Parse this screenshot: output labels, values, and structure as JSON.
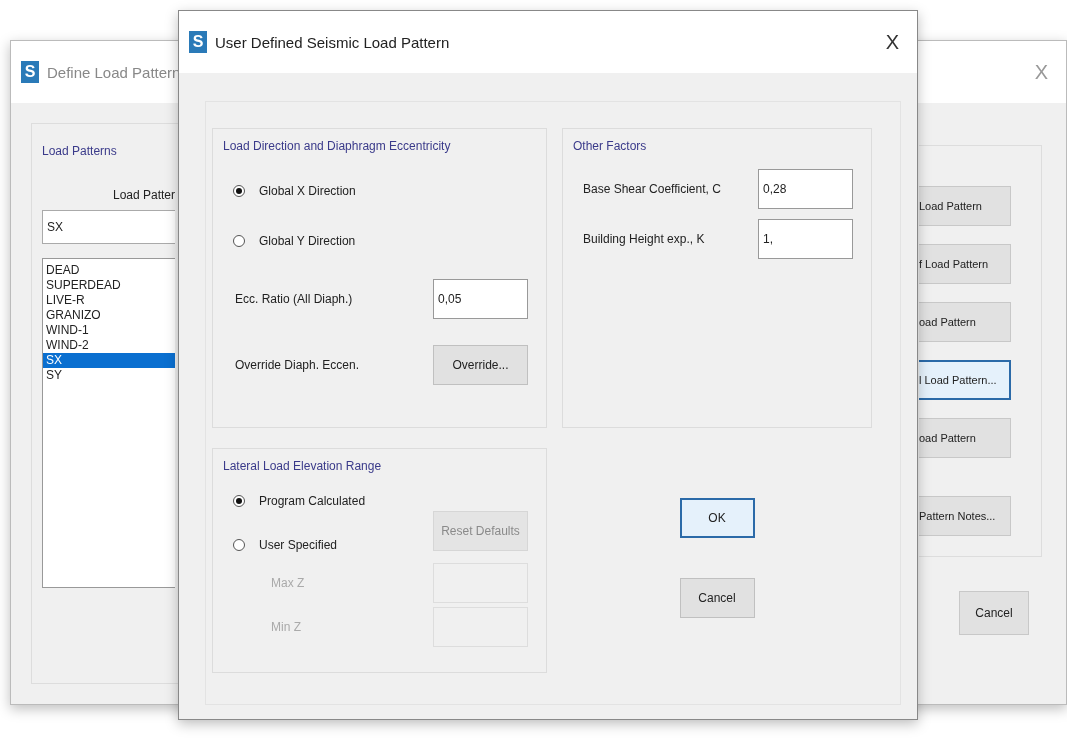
{
  "background_window": {
    "app_icon": "S",
    "title": "Define Load Pattern",
    "close": "X",
    "group_title": "Load Patterns",
    "column_label": "Load Patter",
    "name_field": {
      "value": "SX"
    },
    "patterns": [
      {
        "label": "DEAD",
        "selected": false
      },
      {
        "label": "SUPERDEAD",
        "selected": false
      },
      {
        "label": "LIVE-R",
        "selected": false
      },
      {
        "label": "GRANIZO",
        "selected": false
      },
      {
        "label": "WIND-1",
        "selected": false
      },
      {
        "label": "WIND-2",
        "selected": false
      },
      {
        "label": "SX",
        "selected": true
      },
      {
        "label": "SY",
        "selected": false
      }
    ],
    "buttons": [
      {
        "label": "Load Pattern",
        "focused": false
      },
      {
        "label": "f Load Pattern",
        "focused": false
      },
      {
        "label": "oad Pattern",
        "focused": false
      },
      {
        "label": "l Load Pattern...",
        "focused": true
      },
      {
        "label": "oad Pattern",
        "focused": false
      },
      {
        "label": "Pattern Notes...",
        "focused": false
      }
    ],
    "cancel": "Cancel"
  },
  "dialog": {
    "app_icon": "S",
    "title": "User Defined Seismic Load Pattern",
    "close": "X",
    "direction": {
      "title": "Load Direction and Diaphragm Eccentricity",
      "options": [
        {
          "label": "Global  X  Direction",
          "selected": true
        },
        {
          "label": "Global  Y  Direction",
          "selected": false
        }
      ],
      "ecc_label": "Ecc. Ratio (All Diaph.)",
      "ecc_value": "0,05",
      "override_label": "Override Diaph. Eccen.",
      "override_button": "Override..."
    },
    "other_factors": {
      "title": "Other Factors",
      "fields": [
        {
          "label": "Base Shear Coefficient, C",
          "value": "0,28"
        },
        {
          "label": "Building Height exp., K",
          "value": "1,"
        }
      ]
    },
    "elevation": {
      "title": "Lateral Load Elevation Range",
      "options": [
        {
          "label": "Program Calculated",
          "selected": true
        },
        {
          "label": "User Specified",
          "selected": false
        }
      ],
      "reset_button": {
        "label": "Reset Defaults",
        "disabled": true
      },
      "fields": [
        {
          "label": "Max Z",
          "disabled": true
        },
        {
          "label": "Min Z",
          "disabled": true
        }
      ]
    },
    "buttons": [
      {
        "label": "OK",
        "focused": true
      },
      {
        "label": "Cancel",
        "focused": false
      }
    ]
  }
}
